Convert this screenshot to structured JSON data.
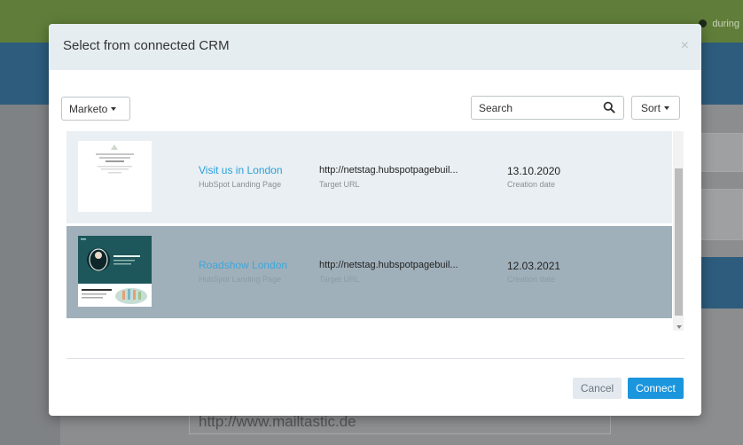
{
  "background": {
    "notice_text": "during"
  },
  "modal": {
    "title": "Select from connected CRM",
    "close_glyph": "×",
    "crm_dropdown": {
      "label": "Marketo",
      "icon": "chevron-down-icon"
    },
    "search": {
      "placeholder": "Search",
      "value": ""
    },
    "sort_label": "Sort",
    "items": [
      {
        "name": "Visit us in London",
        "type": "HubSpot Landing Page",
        "url": "http://netstag.hubspotpagebuil...",
        "url_label": "Target URL",
        "date": "13.10.2020",
        "date_label": "Creation date",
        "selected": false
      },
      {
        "name": "Roadshow London",
        "type": "HubSpot Landing Page",
        "url": "http://netstag.hubspotpagebuil...",
        "url_label": "Target URL",
        "date": "12.03.2021",
        "date_label": "Creation date",
        "selected": true
      }
    ],
    "buttons": {
      "cancel": "Cancel",
      "connect": "Connect"
    }
  },
  "background_field": {
    "url": "http://www.mailtastic.de"
  },
  "colors": {
    "accent": "#1b96dd",
    "link": "#2a9fd9",
    "header_bg": "#e6edf1",
    "selected_row_bg": "#a0b0ba"
  }
}
